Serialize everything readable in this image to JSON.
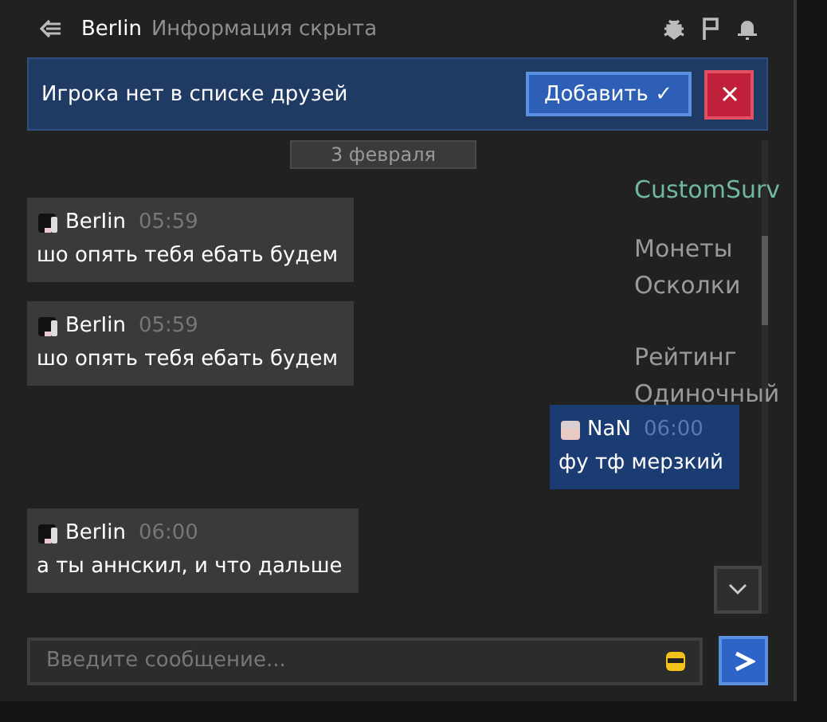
{
  "background_texts": [
    "CustomSurv",
    "Монеты",
    "Осколки",
    "Рейтинг",
    "Одиночный"
  ],
  "header": {
    "name": "BerIin",
    "status": "Информация скрыта"
  },
  "banner": {
    "text": "Игрока нет в списке друзей",
    "add_button": "Добавить ✓"
  },
  "date": "3 февраля",
  "messages": [
    {
      "author": "BerIin",
      "time": "05:59",
      "text": "шо опять тебя ебать будем",
      "own": false
    },
    {
      "author": "BerIin",
      "time": "05:59",
      "text": "шо опять тебя ебать будем",
      "own": false
    },
    {
      "author": "NaN",
      "time": "06:00",
      "text": "фу тф мерзкий",
      "own": true
    },
    {
      "author": "BerIin",
      "time": "06:00",
      "text": "а ты аннскил, и что дальше",
      "own": false
    }
  ],
  "input": {
    "placeholder": "Введите сообщение..."
  }
}
